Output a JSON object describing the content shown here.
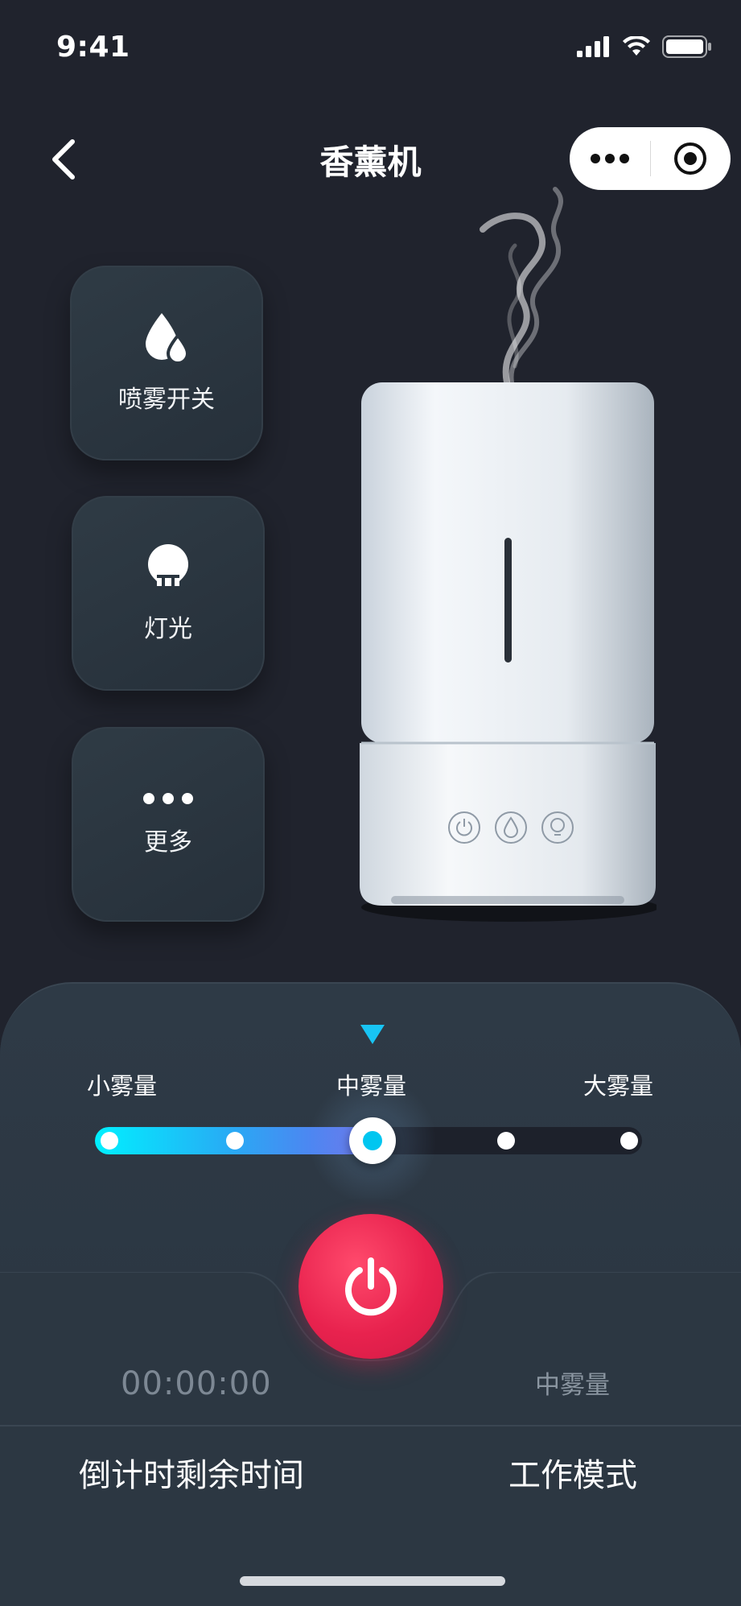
{
  "status": {
    "time": "9:41"
  },
  "nav": {
    "title": "香薰机"
  },
  "side_buttons": [
    {
      "label": "喷雾开关",
      "icon": "water-drops-icon"
    },
    {
      "label": "灯光",
      "icon": "bulb-icon"
    },
    {
      "label": "更多",
      "icon": "more-dots-icon"
    }
  ],
  "device_buttons": [
    "power-icon",
    "drop-icon",
    "bulb-icon"
  ],
  "mist": {
    "levels": [
      "小雾量",
      "中雾量",
      "大雾量"
    ],
    "selected_level": "中雾量",
    "slider_value": 0.5,
    "slider_steps": 5
  },
  "colors": {
    "accent": "#00e6ff",
    "power": "#e8224e",
    "background": "#20232d"
  },
  "footer": {
    "timer_value": "00:00:00",
    "timer_label": "倒计时剩余时间",
    "mode_value": "中雾量",
    "mode_label": "工作模式"
  }
}
